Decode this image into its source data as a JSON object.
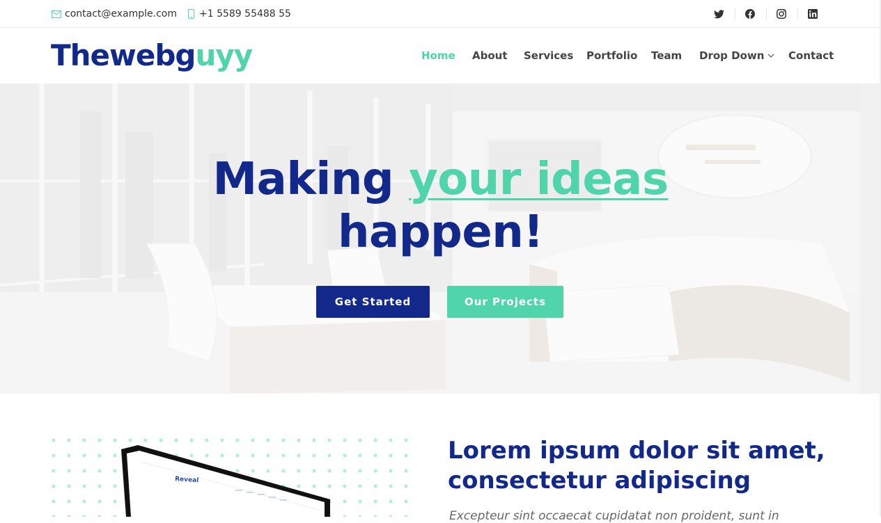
{
  "topbar": {
    "email": "contact@example.com",
    "phone": "+1 5589 55488 55",
    "email_icon": "envelope-icon",
    "phone_icon": "phone-icon",
    "socials": [
      "twitter-icon",
      "facebook-icon",
      "instagram-icon",
      "linkedin-icon"
    ]
  },
  "header": {
    "logo_main": "Thewebg",
    "logo_accent": "uyy",
    "nav": {
      "home": "Home",
      "about": "About",
      "services": "Services",
      "portfolio": "Portfolio",
      "team": "Team",
      "dropdown": "Drop Down",
      "contact": "Contact"
    }
  },
  "hero": {
    "title_part1": "Making ",
    "title_highlight": "your ideas",
    "title_part2": "happen!",
    "btn_primary": "Get Started",
    "btn_secondary": "Our Projects"
  },
  "about": {
    "title": "Lorem ipsum dolor sit amet, consectetur adipiscing",
    "text": "Excepteur sint occaecat cupidatat non proident, sunt in",
    "image_brand": "Reveal"
  },
  "colors": {
    "brand_blue": "#12288a",
    "accent_green": "#4fd5a9",
    "text": "#444444"
  }
}
